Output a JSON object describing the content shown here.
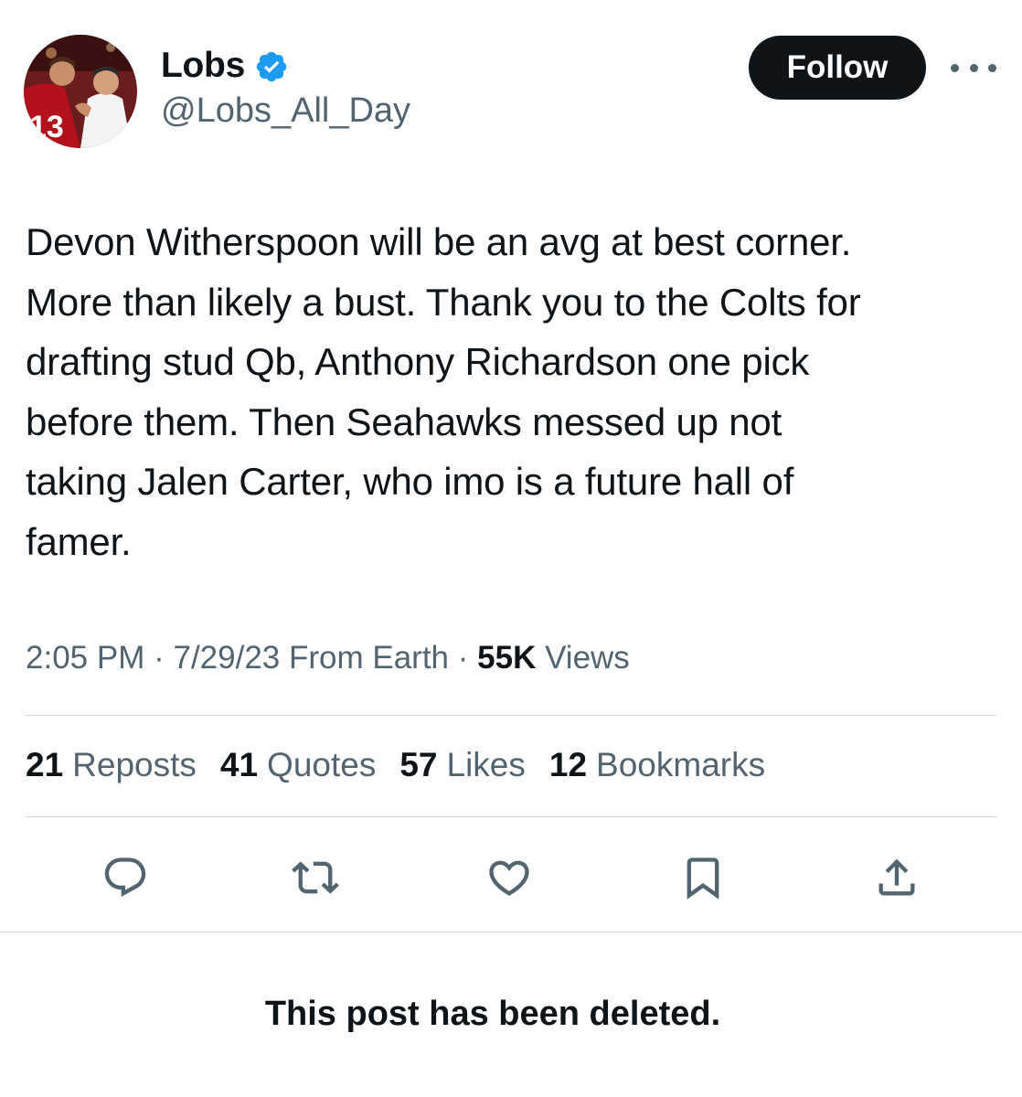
{
  "author": {
    "display_name": "Lobs",
    "handle": "@Lobs_All_Day",
    "verified": true,
    "avatar_icon": "profile-photo"
  },
  "follow_button": {
    "label": "Follow"
  },
  "more_icon": "ellipsis-icon",
  "tweet": {
    "lines": [
      "Devon Witherspoon will be an avg at best corner.",
      "More than likely a bust. Thank you to the Colts for",
      "drafting stud Qb, Anthony Richardson one pick",
      "before them. Then Seahawks messed up not",
      "taking Jalen Carter, who imo is a future hall of",
      "famer."
    ]
  },
  "meta": {
    "time": "2:05 PM",
    "date": "7/29/23",
    "source": "From Earth",
    "views_count": "55K",
    "views_label": "Views",
    "separator": "·"
  },
  "stats": [
    {
      "count": "21",
      "label": "Reposts"
    },
    {
      "count": "41",
      "label": "Quotes"
    },
    {
      "count": "57",
      "label": "Likes"
    },
    {
      "count": "12",
      "label": "Bookmarks"
    }
  ],
  "actions": [
    "reply-icon",
    "repost-icon",
    "like-icon",
    "bookmark-icon",
    "share-icon"
  ],
  "deleted_notice": "This post has been deleted.",
  "colors": {
    "text": "#0f1419",
    "secondary": "#536471",
    "verified": "#1d9bf0",
    "divider": "#cfd9de"
  }
}
